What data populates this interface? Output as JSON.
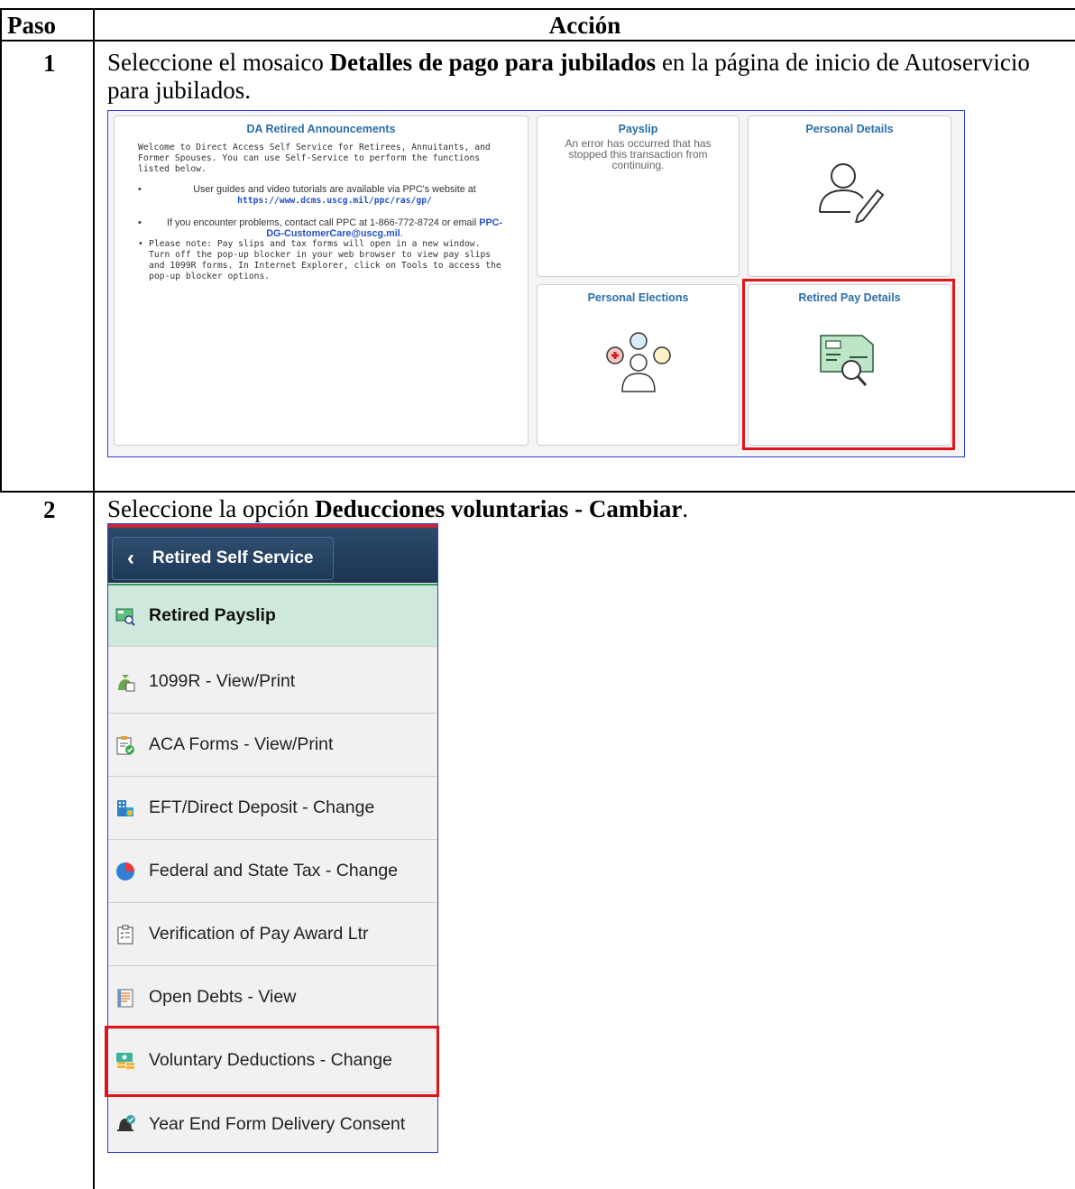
{
  "table": {
    "col_step": "Paso",
    "col_action": "Acción",
    "rows": [
      {
        "step": "1",
        "text_pre": "Seleccione el  mosaico ",
        "text_bold": "Detalles de pago para jubilados",
        "text_post": " en la página de inicio de Autoservicio para jubilados."
      },
      {
        "step": "2",
        "text_pre": "Seleccione la  opción ",
        "text_bold": "Deducciones voluntarias - Cambiar",
        "text_post": "."
      }
    ]
  },
  "home": {
    "announcements": {
      "title": "DA Retired Announcements",
      "intro": "Welcome to Direct Access Self Service for Retirees, Annuitants, and Former Spouses. You can use Self-Service to perform the functions listed below.",
      "bullet1_text": "User guides and video tutorials are available via PPC's website at",
      "bullet1_link": "https://www.dcms.uscg.mil/ppc/ras/gp/",
      "bullet2_text": "If you encounter problems, contact call PPC at 1-866-772-8724 or email",
      "bullet2_link": "PPC-DG-CustomerCare@uscg.mil",
      "bullet3_text": "Please note: Pay slips and tax forms will open in a new window. Turn off the pop-up blocker in your web browser to view pay slips and 1099R forms. In Internet Explorer, click on Tools to access the pop-up blocker options."
    },
    "payslip": {
      "title": "Payslip",
      "error": "An error has occurred that has stopped this transaction from continuing."
    },
    "personal_details": {
      "title": "Personal Details",
      "icon": "person-edit-icon"
    },
    "personal_elections": {
      "title": "Personal Elections",
      "icon": "people-elections-icon"
    },
    "retired_pay_details": {
      "title": "Retired Pay Details",
      "icon": "check-magnifier-icon"
    }
  },
  "nav": {
    "back_label": "Retired Self Service",
    "items": [
      {
        "label": "Retired Payslip",
        "icon": "payslip-icon"
      },
      {
        "label": "1099R - View/Print",
        "icon": "money-bag-icon"
      },
      {
        "label": "ACA Forms - View/Print",
        "icon": "clipboard-check-icon"
      },
      {
        "label": "EFT/Direct Deposit - Change",
        "icon": "bank-building-icon"
      },
      {
        "label": "Federal and State Tax - Change",
        "icon": "pie-chart-icon"
      },
      {
        "label": "Verification of Pay Award Ltr",
        "icon": "checklist-icon"
      },
      {
        "label": "Open Debts - View",
        "icon": "document-list-icon"
      },
      {
        "label": "Voluntary Deductions - Change",
        "icon": "cash-stack-icon"
      },
      {
        "label": "Year End Form Delivery Consent",
        "icon": "bell-check-icon"
      }
    ]
  },
  "colors": {
    "highlight": "#e0141b",
    "tile_title": "#2a6ea8",
    "nav_active": "#cfeadc"
  }
}
